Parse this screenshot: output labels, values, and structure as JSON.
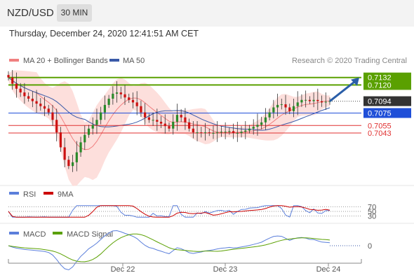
{
  "header": {
    "symbol": "NZD/USD",
    "timeframe": "30 MIN",
    "timestamp": "Thursday, December 24, 2020 12:41:51 AM CET"
  },
  "colors": {
    "bollinger": "#f08080",
    "bollinger_band_fill": "#fdd9d6",
    "ma50": "#3a5aa8",
    "resistance": "#5aa000",
    "pivot": "#1f4fd8",
    "support": "#e03030",
    "current": "#333333",
    "rsi": "#5b7fdb",
    "rsi_9ma": "#cc0000",
    "macd": "#5b7fdb",
    "macd_signal": "#5aa000",
    "candle_up": "#2a8a2a",
    "candle_down": "#cc1111"
  },
  "legend": {
    "ma20": "MA 20 + Bollinger Bands",
    "ma50": "MA 50",
    "source": "Research © 2020 Trading Central",
    "rsi": "RSI",
    "rsi_ma": "9MA",
    "macd": "MACD",
    "macd_signal": "MACD Signal"
  },
  "chart_data": {
    "type": "candlestick",
    "y_range": [
      0.697,
      0.7144
    ],
    "x_ticks": [
      "Dec 22",
      "Dec 23",
      "Dec 24"
    ],
    "levels": [
      {
        "label": "0.7132",
        "value": 0.7132,
        "kind": "resistance"
      },
      {
        "label": "0.7120",
        "value": 0.712,
        "kind": "resistance"
      },
      {
        "label": "0.7094",
        "value": 0.7094,
        "kind": "current"
      },
      {
        "label": "0.7075",
        "value": 0.7075,
        "kind": "pivot"
      },
      {
        "label": "0.7055",
        "value": 0.7055,
        "kind": "support"
      },
      {
        "label": "0.7043",
        "value": 0.7043,
        "kind": "support"
      }
    ],
    "close_series": [
      0.7132,
      0.7122,
      0.7114,
      0.7108,
      0.7102,
      0.7098,
      0.7094,
      0.709,
      0.7086,
      0.7082,
      0.7076,
      0.7064,
      0.7044,
      0.702,
      0.7,
      0.699,
      0.6996,
      0.7012,
      0.7028,
      0.704,
      0.705,
      0.7056,
      0.7064,
      0.7076,
      0.7088,
      0.7098,
      0.7106,
      0.7108,
      0.7105,
      0.71,
      0.7096,
      0.7092,
      0.7086,
      0.7076,
      0.7068,
      0.7064,
      0.7064,
      0.7061,
      0.7058,
      0.7054,
      0.705,
      0.7061,
      0.7072,
      0.7068,
      0.706,
      0.705,
      0.7044,
      0.7044,
      0.7043,
      0.7044,
      0.7043,
      0.7043,
      0.7044,
      0.7045,
      0.7045,
      0.7046,
      0.7043,
      0.7043,
      0.7045,
      0.7047,
      0.705,
      0.7053,
      0.7056,
      0.706,
      0.7068,
      0.7076,
      0.7084,
      0.7088,
      0.7089,
      0.7084,
      0.7078,
      0.7086,
      0.7092,
      0.7096,
      0.7096,
      0.7094,
      0.7096,
      0.7094,
      0.7092,
      0.7093,
      0.7094
    ],
    "rsi": {
      "levels": [
        70,
        50,
        30
      ]
    },
    "macd": {
      "levels": [
        0
      ]
    }
  }
}
